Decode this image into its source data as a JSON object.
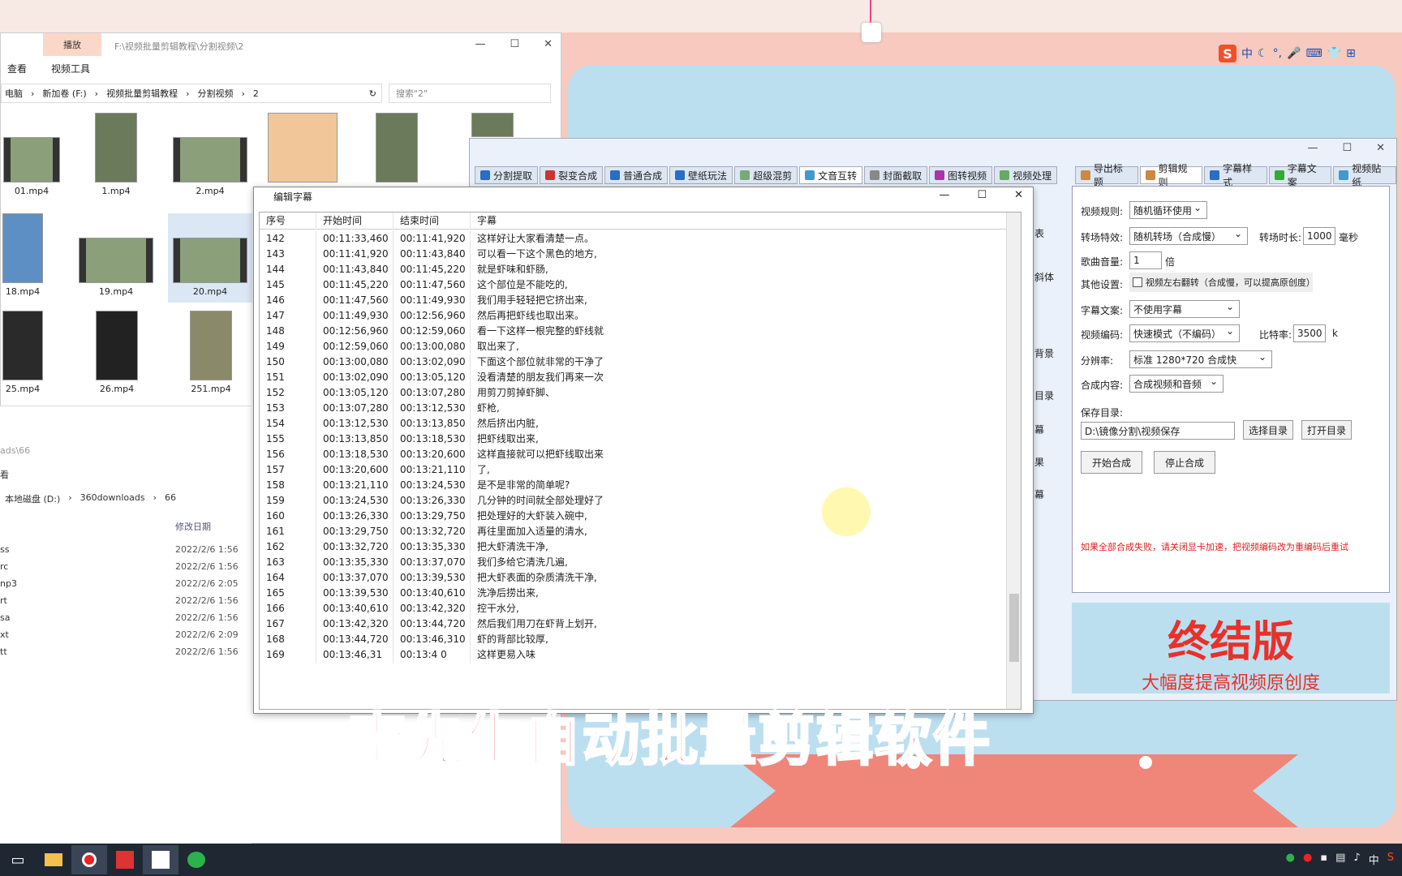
{
  "explorer": {
    "tab_play": "播放",
    "path": "F:\\视频批量剪辑教程\\分割视频\\2",
    "ribbon": [
      "查看",
      "视频工具"
    ],
    "address": [
      "电脑",
      "新加卷 (F:)",
      "视频批量剪辑教程",
      "分割视频",
      "2"
    ],
    "search_placeholder": "搜索\"2\"",
    "files": [
      "01.mp4",
      "1.mp4",
      "2.mp4",
      "18.mp4",
      "19.mp4",
      "20.mp4",
      "25.mp4",
      "26.mp4",
      "251.mp4"
    ]
  },
  "explorer2": {
    "path_tail": "ads\\66",
    "view": "看",
    "address": [
      "本地磁盘 (D:)",
      "360downloads",
      "66"
    ],
    "date_header": "修改日期",
    "rows": [
      {
        "name": "ss",
        "date": "2022/2/6 1:56"
      },
      {
        "name": "rc",
        "date": "2022/2/6 1:56"
      },
      {
        "name": "np3",
        "date": "2022/2/6 2:05"
      },
      {
        "name": "rt",
        "date": "2022/2/6 1:56"
      },
      {
        "name": "sa",
        "date": "2022/2/6 1:56"
      },
      {
        "name": "xt",
        "date": "2022/2/6 2:09"
      },
      {
        "name": "tt",
        "date": "2022/2/6 1:56"
      }
    ]
  },
  "app": {
    "tabs": [
      "分割提取",
      "裂变合成",
      "普通合成",
      "壁纸玩法",
      "超级混剪",
      "文音互转",
      "封面截取",
      "图转视频",
      "视频处理"
    ],
    "right_tabs": [
      "导出标题",
      "剪辑规则",
      "字幕样式",
      "字幕文案",
      "视频贴纸"
    ],
    "left_partial": [
      "表",
      "斜体",
      "背景",
      "目录",
      "幕",
      "果",
      "幕"
    ],
    "settings": {
      "video_rule_label": "视频规则:",
      "video_rule": "随机循环使用",
      "transition_label": "转场特效:",
      "transition": "随机转场（合成慢）",
      "transition_dur_label": "转场时长:",
      "transition_dur": "1000",
      "ms": "毫秒",
      "music_vol_label": "歌曲音量:",
      "music_vol": "1",
      "times": "倍",
      "other_label": "其他设置:",
      "flip": "视频左右翻转（合成慢，可以提高原创度）",
      "subtitle_label": "字幕文案:",
      "subtitle": "不使用字幕",
      "encode_label": "视频编码:",
      "encode": "快速模式（不编码）",
      "bitrate_label": "比特率:",
      "bitrate": "3500",
      "k": "k",
      "resolution_label": "分辨率:",
      "resolution": "标准 1280*720 合成快",
      "content_label": "合成内容:",
      "content": "合成视频和音频",
      "save_label": "保存目录:",
      "save_path": "D:\\镜像分割\\视频保存",
      "choose_dir": "选择目录",
      "open_dir": "打开目录",
      "start": "开始合成",
      "stop": "停止合成",
      "warning": "如果全部合成失败，请关闭显卡加速，把视频编码改为重编码后重试"
    },
    "promo_big": "终结版",
    "promo_small": "大幅度提高视频原创度"
  },
  "editor": {
    "title": "编辑字幕",
    "headers": [
      "序号",
      "开始时间",
      "结束时间",
      "字幕"
    ],
    "rows": [
      [
        "142",
        "00:11:33,460",
        "00:11:41,920",
        "这样好让大家看清楚一点。"
      ],
      [
        "143",
        "00:11:41,920",
        "00:11:43,840",
        "可以看一下这个黑色的地方,"
      ],
      [
        "144",
        "00:11:43,840",
        "00:11:45,220",
        "就是虾味和虾肠,"
      ],
      [
        "145",
        "00:11:45,220",
        "00:11:47,560",
        "这个部位是不能吃的,"
      ],
      [
        "146",
        "00:11:47,560",
        "00:11:49,930",
        "我们用手轻轻把它挤出来,"
      ],
      [
        "147",
        "00:11:49,930",
        "00:12:56,960",
        "然后再把虾线也取出来。"
      ],
      [
        "148",
        "00:12:56,960",
        "00:12:59,060",
        "看一下这样一根完整的虾线就"
      ],
      [
        "149",
        "00:12:59,060",
        "00:13:00,080",
        "取出来了,"
      ],
      [
        "150",
        "00:13:00,080",
        "00:13:02,090",
        "下面这个部位就非常的干净了"
      ],
      [
        "151",
        "00:13:02,090",
        "00:13:05,120",
        "没看清楚的朋友我们再来一次"
      ],
      [
        "152",
        "00:13:05,120",
        "00:13:07,280",
        "用剪刀剪掉虾脚、"
      ],
      [
        "153",
        "00:13:07,280",
        "00:13:12,530",
        "虾枪,"
      ],
      [
        "154",
        "00:13:12,530",
        "00:13:13,850",
        "然后挤出内脏,"
      ],
      [
        "155",
        "00:13:13,850",
        "00:13:18,530",
        "把虾线取出来,"
      ],
      [
        "156",
        "00:13:18,530",
        "00:13:20,600",
        "这样直接就可以把虾线取出来"
      ],
      [
        "157",
        "00:13:20,600",
        "00:13:21,110",
        "了,"
      ],
      [
        "158",
        "00:13:21,110",
        "00:13:24,530",
        "是不是非常的简单呢?"
      ],
      [
        "159",
        "00:13:24,530",
        "00:13:26,330",
        "几分钟的时间就全部处理好了"
      ],
      [
        "160",
        "00:13:26,330",
        "00:13:29,750",
        "把处理好的大虾装入碗中,"
      ],
      [
        "161",
        "00:13:29,750",
        "00:13:32,720",
        "再往里面加入适量的清水,"
      ],
      [
        "162",
        "00:13:32,720",
        "00:13:35,330",
        "把大虾清洗干净,"
      ],
      [
        "163",
        "00:13:35,330",
        "00:13:37,070",
        "我们多给它清洗几遍,"
      ],
      [
        "164",
        "00:13:37,070",
        "00:13:39,530",
        "把大虾表面的杂质清洗干净,"
      ],
      [
        "165",
        "00:13:39,530",
        "00:13:40,610",
        "洗净后捞出来,"
      ],
      [
        "166",
        "00:13:40,610",
        "00:13:42,320",
        "控干水分,"
      ],
      [
        "167",
        "00:13:42,320",
        "00:13:44,720",
        "然后我们用刀在虾背上划开,"
      ],
      [
        "168",
        "00:13:44,720",
        "00:13:46,310",
        "虾的背部比较厚,"
      ],
      [
        "169",
        "00:13:46,31",
        "00:13:4 0",
        "这样更易入味"
      ]
    ]
  },
  "overlay_title": "李先生自动批量剪辑软件",
  "ime": [
    "中",
    "☾",
    "°,",
    "🎤",
    "⌨",
    "👕",
    "⊞"
  ],
  "tray": [
    "中",
    "S"
  ]
}
